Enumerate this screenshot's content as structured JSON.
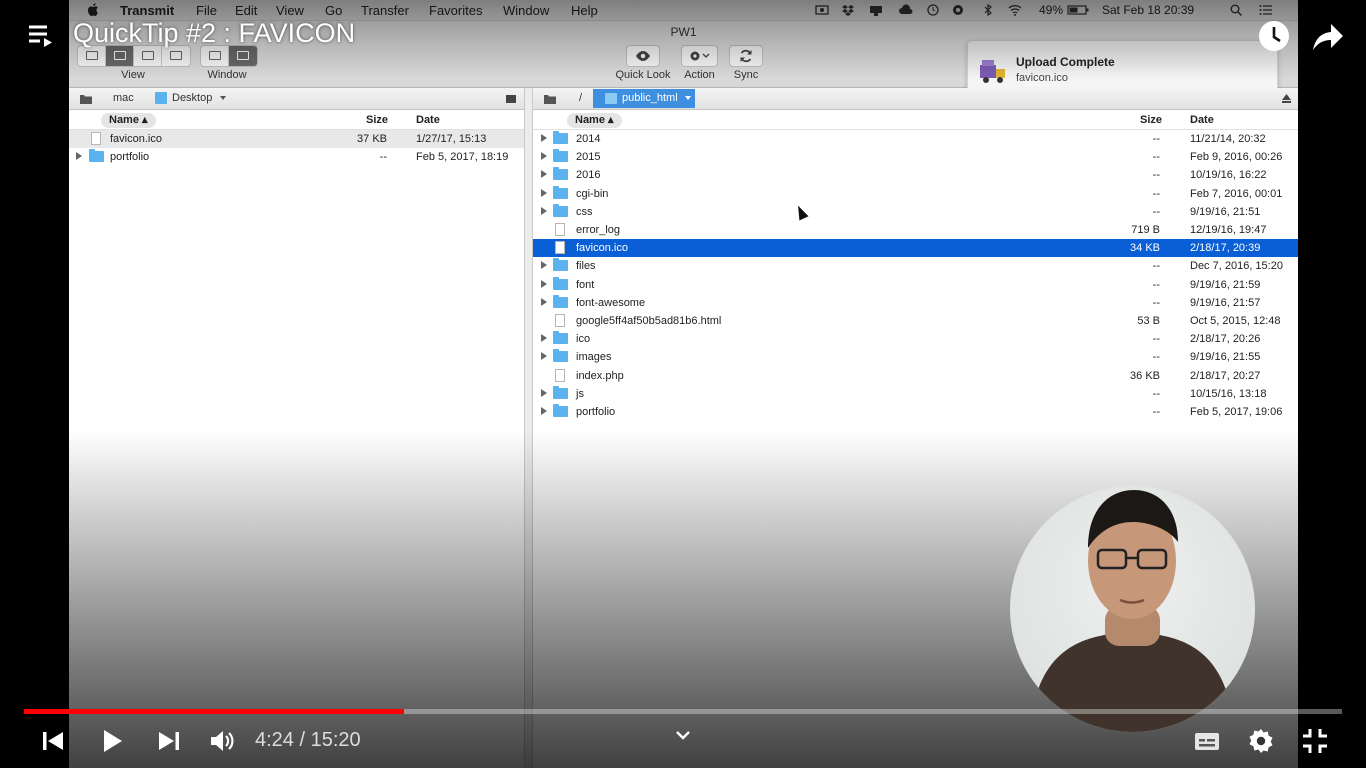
{
  "video": {
    "title": "QuickTip #2 : FAVICON",
    "time_current": "4:24",
    "time_separator": "/",
    "time_total": "15:20",
    "progress_fraction": 0.288
  },
  "menubar": {
    "app_name": "Transmit",
    "items": [
      "File",
      "Edit",
      "View",
      "Go",
      "Transfer",
      "Favorites",
      "Window",
      "Help"
    ],
    "battery": "49%",
    "clock": "Sat Feb 18  20:39"
  },
  "toolbar": {
    "window_title": "PW1",
    "view_label": "View",
    "window_label": "Window",
    "quicklook_label": "Quick Look",
    "action_label": "Action",
    "sync_label": "Sync"
  },
  "notification": {
    "title": "Upload Complete",
    "subtitle": "favicon.ico"
  },
  "left_pane": {
    "path": [
      "mac",
      "Desktop"
    ],
    "columns": {
      "name": "Name",
      "size": "Size",
      "date": "Date"
    },
    "rows": [
      {
        "name": "favicon.ico",
        "size": "37 KB",
        "date": "1/27/17, 15:13",
        "kind": "file"
      },
      {
        "name": "portfolio",
        "size": "--",
        "date": "Feb 5, 2017, 18:19",
        "kind": "folder"
      }
    ]
  },
  "right_pane": {
    "path": [
      "/",
      "public_html"
    ],
    "columns": {
      "name": "Name",
      "size": "Size",
      "date": "Date"
    },
    "rows": [
      {
        "name": "2014",
        "size": "--",
        "date": "11/21/14, 20:32",
        "kind": "folder"
      },
      {
        "name": "2015",
        "size": "--",
        "date": "Feb 9, 2016, 00:26",
        "kind": "folder"
      },
      {
        "name": "2016",
        "size": "--",
        "date": "10/19/16, 16:22",
        "kind": "folder"
      },
      {
        "name": "cgi-bin",
        "size": "--",
        "date": "Feb 7, 2016, 00:01",
        "kind": "folder"
      },
      {
        "name": "css",
        "size": "--",
        "date": "9/19/16, 21:51",
        "kind": "folder"
      },
      {
        "name": "error_log",
        "size": "719 B",
        "date": "12/19/16, 19:47",
        "kind": "file"
      },
      {
        "name": "favicon.ico",
        "size": "34 KB",
        "date": "2/18/17, 20:39",
        "kind": "file",
        "selected": true
      },
      {
        "name": "files",
        "size": "--",
        "date": "Dec 7, 2016, 15:20",
        "kind": "folder"
      },
      {
        "name": "font",
        "size": "--",
        "date": "9/19/16, 21:59",
        "kind": "folder"
      },
      {
        "name": "font-awesome",
        "size": "--",
        "date": "9/19/16, 21:57",
        "kind": "folder"
      },
      {
        "name": "google5ff4af50b5ad81b6.html",
        "size": "53 B",
        "date": "Oct 5, 2015, 12:48",
        "kind": "file"
      },
      {
        "name": "ico",
        "size": "--",
        "date": "2/18/17, 20:26",
        "kind": "folder"
      },
      {
        "name": "images",
        "size": "--",
        "date": "9/19/16, 21:55",
        "kind": "folder"
      },
      {
        "name": "index.php",
        "size": "36 KB",
        "date": "2/18/17, 20:27",
        "kind": "file"
      },
      {
        "name": "js",
        "size": "--",
        "date": "10/15/16, 13:18",
        "kind": "folder"
      },
      {
        "name": "portfolio",
        "size": "--",
        "date": "Feb 5, 2017, 19:06",
        "kind": "folder"
      }
    ]
  },
  "icons": [
    "playlist-icon",
    "watch-later-icon",
    "share-icon",
    "skip-previous-icon",
    "play-icon",
    "skip-next-icon",
    "volume-icon",
    "chevron-down-icon",
    "subtitles-icon",
    "settings-icon",
    "exit-fullscreen-icon"
  ],
  "colors": {
    "progress": "#ff0000",
    "selection": "#0b5fd6",
    "folder": "#5ab3ee"
  }
}
